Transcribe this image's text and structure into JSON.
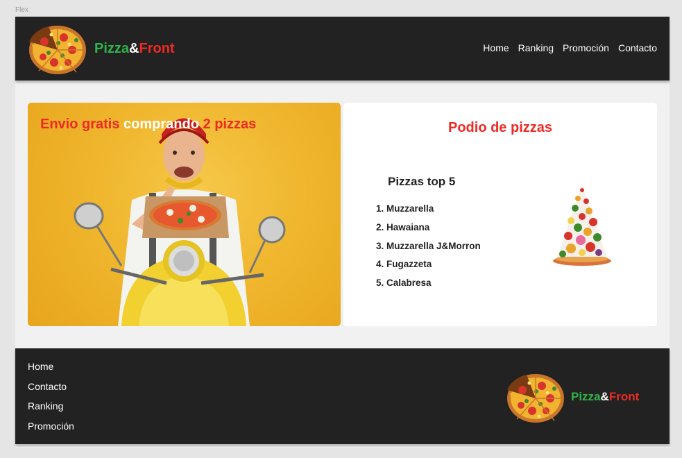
{
  "frame": {
    "label": "Flex"
  },
  "header": {
    "brand": {
      "part1": "Pizza",
      "part2": "&",
      "part3": "Front"
    },
    "nav": [
      "Home",
      "Ranking",
      "Promoción",
      "Contacto"
    ]
  },
  "promo": {
    "title_part1": "Envio gratis",
    "title_part2": "comprando",
    "title_part3": "2 pizzas"
  },
  "podio": {
    "title": "Podio de pizzas",
    "list_title": "Pizzas top 5",
    "items": [
      "1. Muzzarella",
      "2. Hawaiana",
      "3. Muzzarella J&Morron",
      "4. Fugazzeta",
      "5. Calabresa"
    ]
  },
  "footer": {
    "links": [
      "Home",
      "Contacto",
      "Ranking",
      "Promoción"
    ],
    "brand": {
      "part1": "Pizza",
      "part2": "&",
      "part3": "Front"
    }
  },
  "colors": {
    "dark": "#222222",
    "brand_green": "#2fb54a",
    "brand_red": "#ee2a24",
    "promo_yellow": "#f0b72e",
    "page_bg": "#f1f1f1"
  },
  "icons": [
    "pizza-logo-icon",
    "pizza-tower-image",
    "delivery-photo"
  ]
}
